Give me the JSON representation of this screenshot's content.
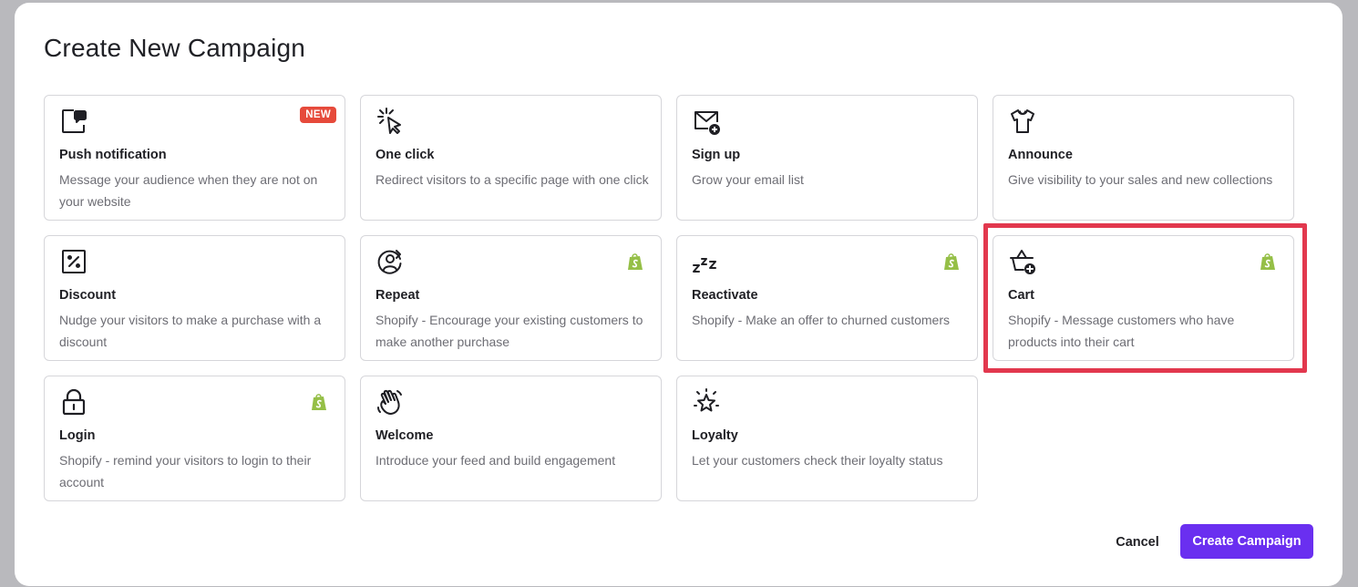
{
  "modal": {
    "title": "Create New Campaign"
  },
  "cards": [
    {
      "icon": "push-notification-icon",
      "title": "Push notification",
      "description": "Message your audience when they are not on your website",
      "badge": "NEW"
    },
    {
      "icon": "cursor-click-icon",
      "title": "One click",
      "description": "Redirect visitors to a specific page with one click"
    },
    {
      "icon": "email-add-icon",
      "title": "Sign up",
      "description": "Grow your email list"
    },
    {
      "icon": "tshirt-icon",
      "title": "Announce",
      "description": "Give visibility to your sales and new collections"
    },
    {
      "icon": "percent-icon",
      "title": "Discount",
      "description": "Nudge your visitors to make a purchase with a discount"
    },
    {
      "icon": "repeat-user-icon",
      "title": "Repeat",
      "description": "Shopify - Encourage your existing customers to make another purchase",
      "shopify": true
    },
    {
      "icon": "sleep-zzz-icon",
      "title": "Reactivate",
      "description": "Shopify - Make an offer to churned customers",
      "shopify": true
    },
    {
      "icon": "cart-add-icon",
      "title": "Cart",
      "description": "Shopify - Message customers who have products into their cart",
      "shopify": true,
      "highlighted": true
    },
    {
      "icon": "lock-icon",
      "title": "Login",
      "description": "Shopify - remind your visitors to login to their account",
      "shopify": true
    },
    {
      "icon": "waving-hand-icon",
      "title": "Welcome",
      "description": "Introduce your feed and build engagement"
    },
    {
      "icon": "sparkle-star-icon",
      "title": "Loyalty",
      "description": "Let your customers check their loyalty status"
    }
  ],
  "footer": {
    "cancel_label": "Cancel",
    "create_label": "Create Campaign"
  },
  "colors": {
    "primary": "#6a2ff0",
    "badge_new": "#e64a3b",
    "highlight": "#e2384e",
    "shopify_green": "#95bf47",
    "description_text": "#6d6d74"
  }
}
